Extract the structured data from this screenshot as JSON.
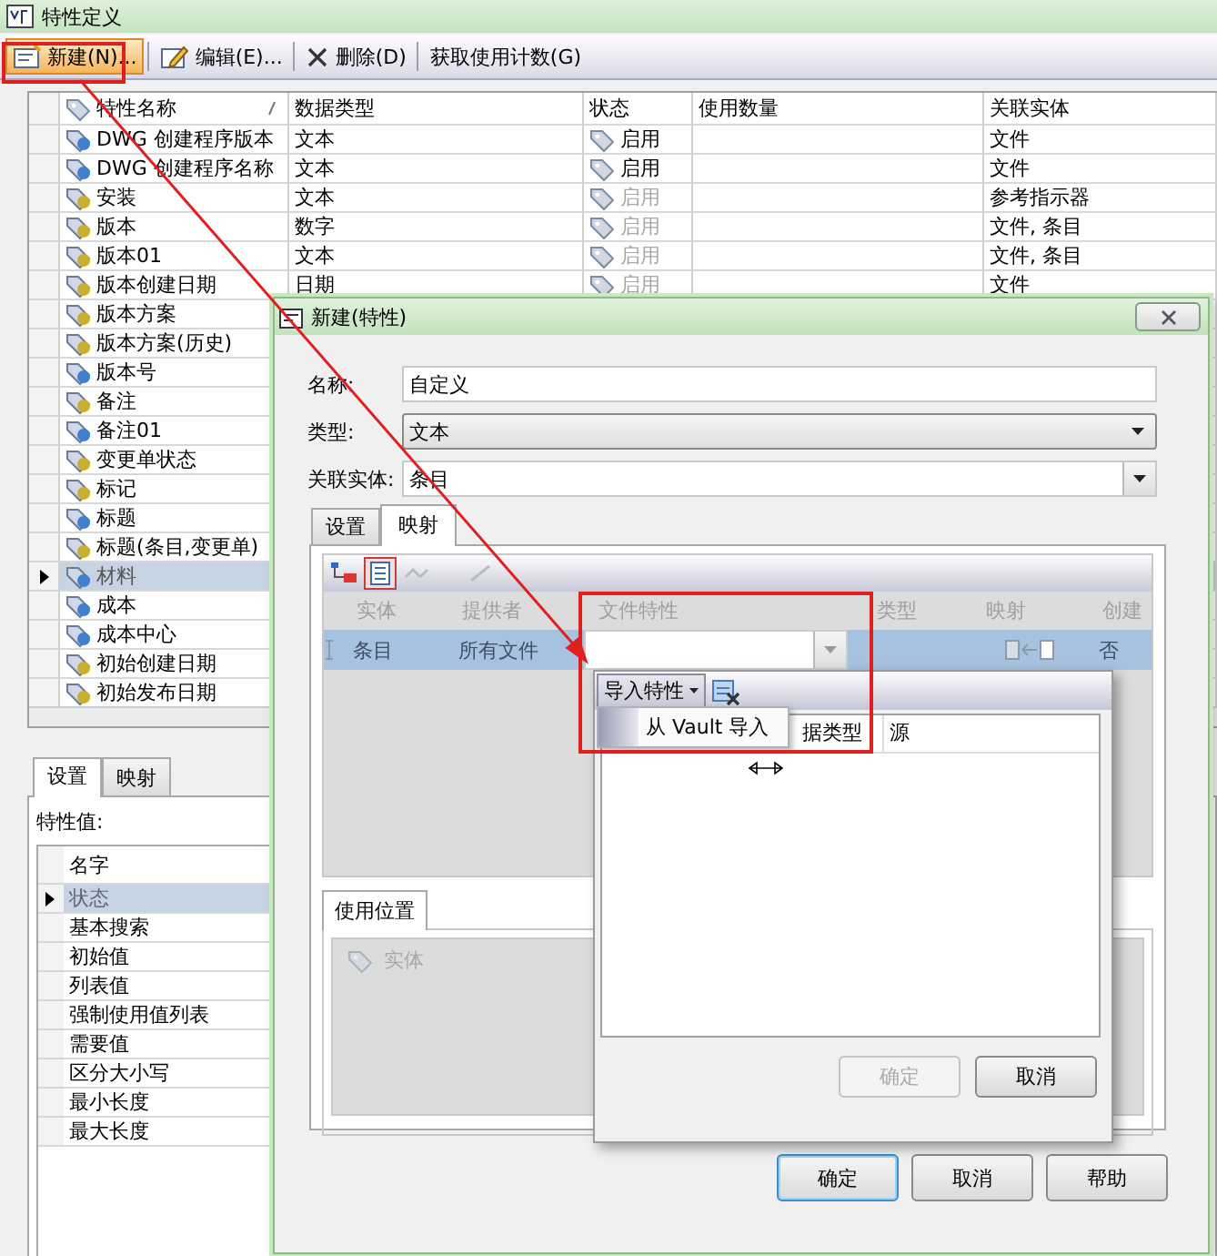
{
  "window": {
    "title": "特性定义"
  },
  "toolbar": [
    {
      "label": "新建(N)...",
      "kind": "new",
      "hover": true
    },
    {
      "label": "编辑(E)...",
      "kind": "edit",
      "hover": false
    },
    {
      "label": "删除(D)",
      "kind": "delete",
      "hover": false
    },
    {
      "label": "获取使用计数(G)",
      "hover": false
    }
  ],
  "table": {
    "columns": [
      "特性名称",
      "数据类型",
      "状态",
      "使用数量",
      "关联实体"
    ],
    "rows": [
      {
        "name": "DWG 创建程序版本",
        "color": "#3f7fcf",
        "data_type": "文本",
        "status": "启用",
        "dimmed": false,
        "entity": "文件",
        "selected": false
      },
      {
        "name": "DWG 创建程序名称",
        "color": "#3f7fcf",
        "data_type": "文本",
        "status": "启用",
        "dimmed": false,
        "entity": "文件",
        "selected": false
      },
      {
        "name": "安装",
        "color": "#c9b02a",
        "data_type": "文本",
        "status": "启用",
        "dimmed": true,
        "entity": "参考指示器",
        "selected": false
      },
      {
        "name": "版本",
        "color": "#c9b02a",
        "data_type": "数字",
        "status": "启用",
        "dimmed": true,
        "entity": "文件, 条目",
        "selected": false
      },
      {
        "name": "版本01",
        "color": "#c9b02a",
        "data_type": "文本",
        "status": "启用",
        "dimmed": true,
        "entity": "文件, 条目",
        "selected": false
      },
      {
        "name": "版本创建日期",
        "color": "#c9b02a",
        "data_type": "日期",
        "status": "启用",
        "dimmed": true,
        "entity": "文件",
        "selected": false
      },
      {
        "name": "版本方案",
        "color": "#c9b02a",
        "selected": false
      },
      {
        "name": "版本方案(历史)",
        "color": "#c9b02a",
        "selected": false
      },
      {
        "name": "版本号",
        "color": "#3f7fcf",
        "selected": false
      },
      {
        "name": "备注",
        "color": "#c9b02a",
        "selected": false
      },
      {
        "name": "备注01",
        "color": "#3f7fcf",
        "selected": false
      },
      {
        "name": "变更单状态",
        "color": "#c9b02a",
        "selected": false
      },
      {
        "name": "标记",
        "color": "#c9b02a",
        "selected": false
      },
      {
        "name": "标题",
        "color": "#3f7fcf",
        "selected": false
      },
      {
        "name": "标题(条目,变更单)",
        "color": "#c9b02a",
        "selected": false
      },
      {
        "name": "材料",
        "color": "#3f7fcf",
        "selected": true
      },
      {
        "name": "成本",
        "color": "#3f7fcf",
        "selected": false
      },
      {
        "name": "成本中心",
        "color": "#3f7fcf",
        "selected": false
      },
      {
        "name": "初始创建日期",
        "color": "#c9b02a",
        "selected": false
      },
      {
        "name": "初始发布日期",
        "color": "#c9b02a",
        "selected": false
      }
    ]
  },
  "details": {
    "tabs": [
      {
        "label": "设置",
        "selected": true
      },
      {
        "label": "映射",
        "selected": false
      }
    ],
    "label": "特性值:",
    "column": "名字",
    "rows": [
      {
        "label": "状态",
        "selected": true
      },
      {
        "label": "基本搜索",
        "selected": false
      },
      {
        "label": "初始值",
        "selected": false
      },
      {
        "label": "列表值",
        "selected": false
      },
      {
        "label": "强制使用值列表",
        "selected": false
      },
      {
        "label": "需要值",
        "selected": false
      },
      {
        "label": "区分大小写",
        "selected": false
      },
      {
        "label": "最小长度",
        "selected": false
      },
      {
        "label": "最大长度",
        "selected": false
      }
    ]
  },
  "dialog": {
    "title": "新建(特性)",
    "fields": [
      {
        "label": "名称:",
        "value": "自定义",
        "kind": "text"
      },
      {
        "label": "类型:",
        "value": "文本",
        "kind": "select"
      },
      {
        "label": "关联实体:",
        "value": "条目",
        "kind": "combo"
      }
    ],
    "tabs": [
      {
        "label": "设置",
        "selected": false
      },
      {
        "label": "映射",
        "selected": true
      }
    ],
    "mapping": {
      "columns": [
        "实体",
        "提供者",
        "文件特性",
        "类型",
        "映射",
        "创建"
      ],
      "rows": [
        {
          "entity": "条目",
          "provider": "所有文件",
          "create": "否",
          "selected": true
        }
      ]
    },
    "usage_tab": "使用位置",
    "usage_column": "实体",
    "buttons": [
      {
        "label": "确定",
        "default": true
      },
      {
        "label": "取消",
        "default": false
      },
      {
        "label": "帮助",
        "default": false
      }
    ]
  },
  "popup": {
    "menu_button": "导入特性",
    "menu_items": [
      "从 Vault 导入"
    ],
    "columns": [
      "据类型",
      "源"
    ],
    "buttons": [
      {
        "label": "确定",
        "disabled": true
      },
      {
        "label": "取消",
        "disabled": false
      }
    ]
  },
  "annotations": [
    {
      "kind": "frame"
    },
    {
      "kind": "frame"
    },
    {
      "kind": "arrow"
    }
  ]
}
